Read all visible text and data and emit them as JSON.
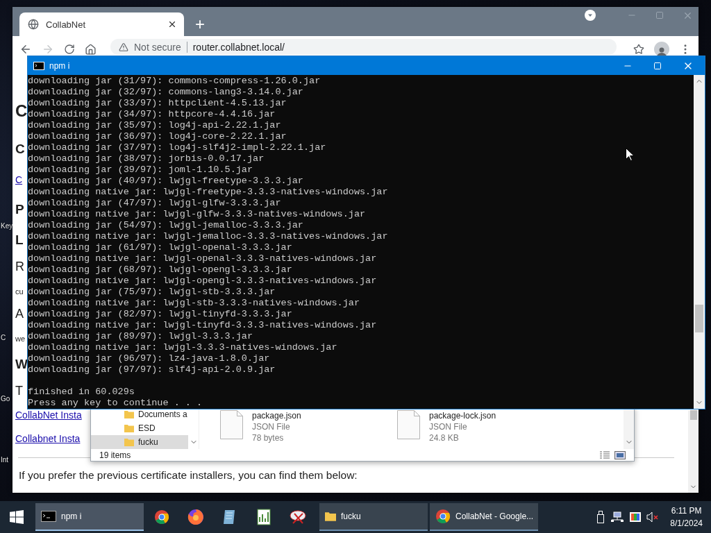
{
  "desktop": {
    "icon_labels": [
      "Key",
      "C",
      "Go",
      "Int"
    ]
  },
  "browser": {
    "tab": {
      "title": "CollabNet",
      "selected": true
    },
    "new_tab": "+",
    "address": {
      "security": "Not secure",
      "url": "router.collabnet.local/"
    },
    "page": {
      "fragments": [
        {
          "text": "C",
          "kind": "h1"
        },
        {
          "text": "C",
          "kind": "h2"
        },
        {
          "text": "C",
          "kind": "link"
        },
        {
          "text": "P",
          "kind": "h2"
        },
        {
          "text": "L",
          "kind": "h2"
        },
        {
          "text": "R",
          "kind": "text"
        },
        {
          "text": "cu",
          "kind": "small"
        },
        {
          "text": "A",
          "kind": "text"
        },
        {
          "text": "we",
          "kind": "small"
        },
        {
          "text": "W",
          "kind": "h2"
        },
        {
          "text": "T",
          "kind": "text"
        },
        {
          "text": "CollabNet Insta",
          "kind": "link"
        },
        {
          "text": "Collabnet Insta",
          "kind": "link"
        }
      ],
      "paragraph": "If you prefer the previous certificate installers, you can find them below:"
    }
  },
  "explorer": {
    "nav_items": [
      {
        "label": "Documents a",
        "selected": false
      },
      {
        "label": "ESD",
        "selected": false
      },
      {
        "label": "fucku",
        "selected": true
      }
    ],
    "files": [
      {
        "name": "package.json",
        "type": "JSON File",
        "size": "78 bytes"
      },
      {
        "name": "package-lock.json",
        "type": "JSON File",
        "size": "24.8 KB"
      }
    ],
    "status": "19 items"
  },
  "terminal": {
    "title": "npm i",
    "lines": [
      "downloading jar (31/97): commons-compress-1.26.0.jar",
      "downloading jar (32/97): commons-lang3-3.14.0.jar",
      "downloading jar (33/97): httpclient-4.5.13.jar",
      "downloading jar (34/97): httpcore-4.4.16.jar",
      "downloading jar (35/97): log4j-api-2.22.1.jar",
      "downloading jar (36/97): log4j-core-2.22.1.jar",
      "downloading jar (37/97): log4j-slf4j2-impl-2.22.1.jar",
      "downloading jar (38/97): jorbis-0.0.17.jar",
      "downloading jar (39/97): joml-1.10.5.jar",
      "downloading jar (40/97): lwjgl-freetype-3.3.3.jar",
      "downloading native jar: lwjgl-freetype-3.3.3-natives-windows.jar",
      "downloading jar (47/97): lwjgl-glfw-3.3.3.jar",
      "downloading native jar: lwjgl-glfw-3.3.3-natives-windows.jar",
      "downloading jar (54/97): lwjgl-jemalloc-3.3.3.jar",
      "downloading native jar: lwjgl-jemalloc-3.3.3-natives-windows.jar",
      "downloading jar (61/97): lwjgl-openal-3.3.3.jar",
      "downloading native jar: lwjgl-openal-3.3.3-natives-windows.jar",
      "downloading jar (68/97): lwjgl-opengl-3.3.3.jar",
      "downloading native jar: lwjgl-opengl-3.3.3-natives-windows.jar",
      "downloading jar (75/97): lwjgl-stb-3.3.3.jar",
      "downloading native jar: lwjgl-stb-3.3.3-natives-windows.jar",
      "downloading jar (82/97): lwjgl-tinyfd-3.3.3.jar",
      "downloading native jar: lwjgl-tinyfd-3.3.3-natives-windows.jar",
      "downloading jar (89/97): lwjgl-3.3.3.jar",
      "downloading native jar: lwjgl-3.3.3-natives-windows.jar",
      "downloading jar (96/97): lz4-java-1.8.0.jar",
      "downloading jar (97/97): slf4j-api-2.0.9.jar"
    ],
    "footer_lines": [
      "finished in 60.029s",
      "Press any key to continue . . ."
    ]
  },
  "taskbar": {
    "windows": [
      {
        "label": "npm i",
        "selected": true
      },
      {
        "label": "fucku",
        "selected": false
      },
      {
        "label": "CollabNet - Google...",
        "selected": false
      }
    ],
    "clock": {
      "time": "6:11 PM",
      "date": "8/1/2024"
    }
  }
}
